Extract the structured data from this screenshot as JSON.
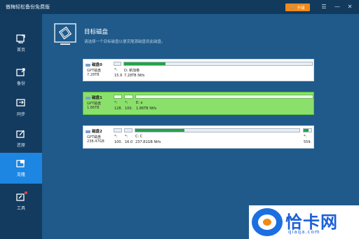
{
  "app": {
    "title": "傲梅轻松备份免费版"
  },
  "header": {
    "upgrade_label": "升级"
  },
  "sidebar": {
    "items": [
      {
        "label": "首页"
      },
      {
        "label": "备份"
      },
      {
        "label": "同步"
      },
      {
        "label": "还原"
      },
      {
        "label": "克隆"
      },
      {
        "label": "工具"
      }
    ]
  },
  "main": {
    "title": "目标磁盘",
    "subtitle": "请选择一个目标磁盘以便克隆源磁盘到此磁盘。"
  },
  "disks": [
    {
      "name": "磁盘0",
      "type": "GPT磁盘",
      "size": "7.28TB",
      "selected": false,
      "partitions": [
        {
          "label": "*:",
          "detail": "15.9",
          "fill": 0.0
        },
        {
          "label": "*:",
          "detail": "128.",
          "fill": 0.0
        },
        {
          "label": "D: 新加卷",
          "detail": "7.28TB Ntfs",
          "fill": 0.22
        }
      ]
    },
    {
      "name": "磁盘1",
      "type": "GPT磁盘",
      "size": "1.86TB",
      "selected": true,
      "partitions": [
        {
          "label": "*:",
          "detail": "128.",
          "fill": 0.0
        },
        {
          "label": "*:",
          "detail": "100.",
          "fill": 0.0
        },
        {
          "label": "E: e",
          "detail": "1.86TB Ntfs",
          "fill": 0.0
        }
      ]
    },
    {
      "name": "磁盘2",
      "type": "GPT磁盘",
      "size": "238.47GB",
      "selected": false,
      "partitions": [
        {
          "label": "*:",
          "detail": "100.",
          "fill": 0.0
        },
        {
          "label": "*:",
          "detail": "16.0",
          "fill": 0.0
        },
        {
          "label": "C: C",
          "detail": "237.81GB Ntfs",
          "fill": 0.3
        },
        {
          "label": "*:",
          "detail": "559.",
          "fill": 0.6
        }
      ]
    }
  ],
  "watermark": {
    "brand": "恰卡网",
    "url": "qiaqa.com"
  },
  "colors": {
    "accent": "#1c86e2",
    "selected_disk": "#8be06c",
    "usage_fill": "#22a447",
    "upgrade": "#f08a1c"
  }
}
